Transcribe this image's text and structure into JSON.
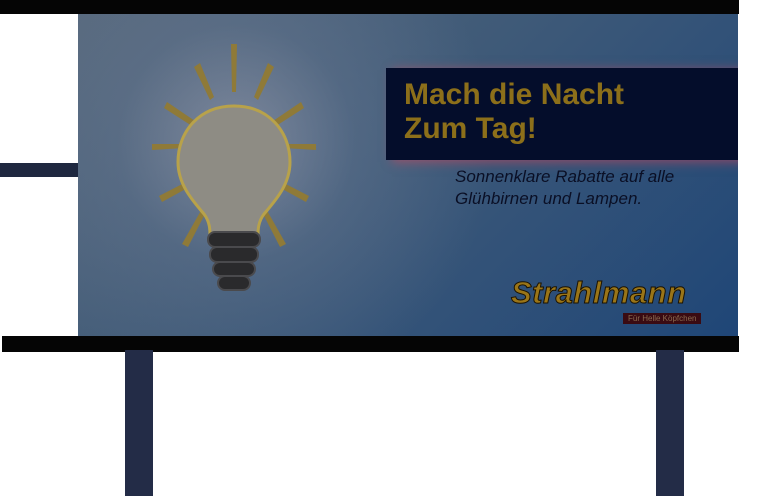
{
  "billboard": {
    "headline_line1": "Mach die Nacht",
    "headline_line2": "Zum Tag!",
    "subtitle_line1": "Sonnenklare Rabatte auf alle",
    "subtitle_line2": "Glühbirnen und Lampen.",
    "brand_name": "Strahlmann",
    "brand_tagline": "Für Helle Köpfchen",
    "icon": "light-bulb-icon"
  },
  "colors": {
    "panel_blue": "#3f5a78",
    "headline_box": "#040d2b",
    "headline_text": "#8c6f1a",
    "brand_text": "#9a7518",
    "frame": "#050505",
    "posts": "#232c47"
  }
}
